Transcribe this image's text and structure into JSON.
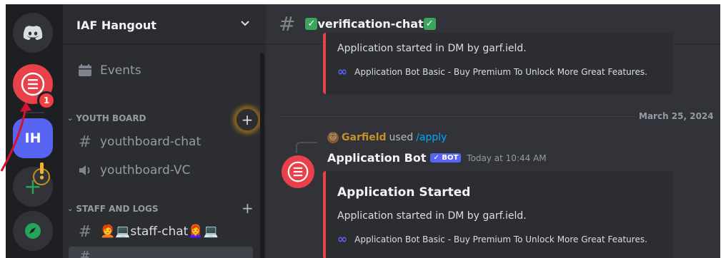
{
  "server": {
    "name": "IAF Hangout",
    "initials": "IH",
    "notification_count": "1"
  },
  "sidebar": {
    "events_label": "Events",
    "categories": [
      {
        "name": "YOUTH BOARD"
      },
      {
        "name": "STAFF AND LOGS"
      }
    ],
    "channels": [
      {
        "name": "youthboard-chat"
      },
      {
        "name": "youthboard-VC"
      },
      {
        "name": "🧑‍🦰💻staff-chat👩‍🦰💻"
      }
    ]
  },
  "channel": {
    "title": "verification-chat"
  },
  "messages": {
    "prev_embed": {
      "desc": "Application started in DM by garf.ield.",
      "footer": "Application Bot Basic - Buy Premium To Unlock More Great Features."
    },
    "date_divider": "March 25, 2024",
    "reply": {
      "user": "Garfield",
      "used": "used",
      "command": "/apply"
    },
    "current": {
      "author": "Application Bot",
      "bot_tag": "✓ BOT",
      "timestamp": "Today at 10:44 AM",
      "embed": {
        "title": "Application Started",
        "desc": "Application started in DM by garf.ield.",
        "footer": "Application Bot Basic - Buy Premium To Unlock More Great Features."
      }
    }
  },
  "colors": {
    "accent": "#5865f2",
    "app_red": "#e8414a",
    "annotation_arrow": "#d0142f"
  }
}
